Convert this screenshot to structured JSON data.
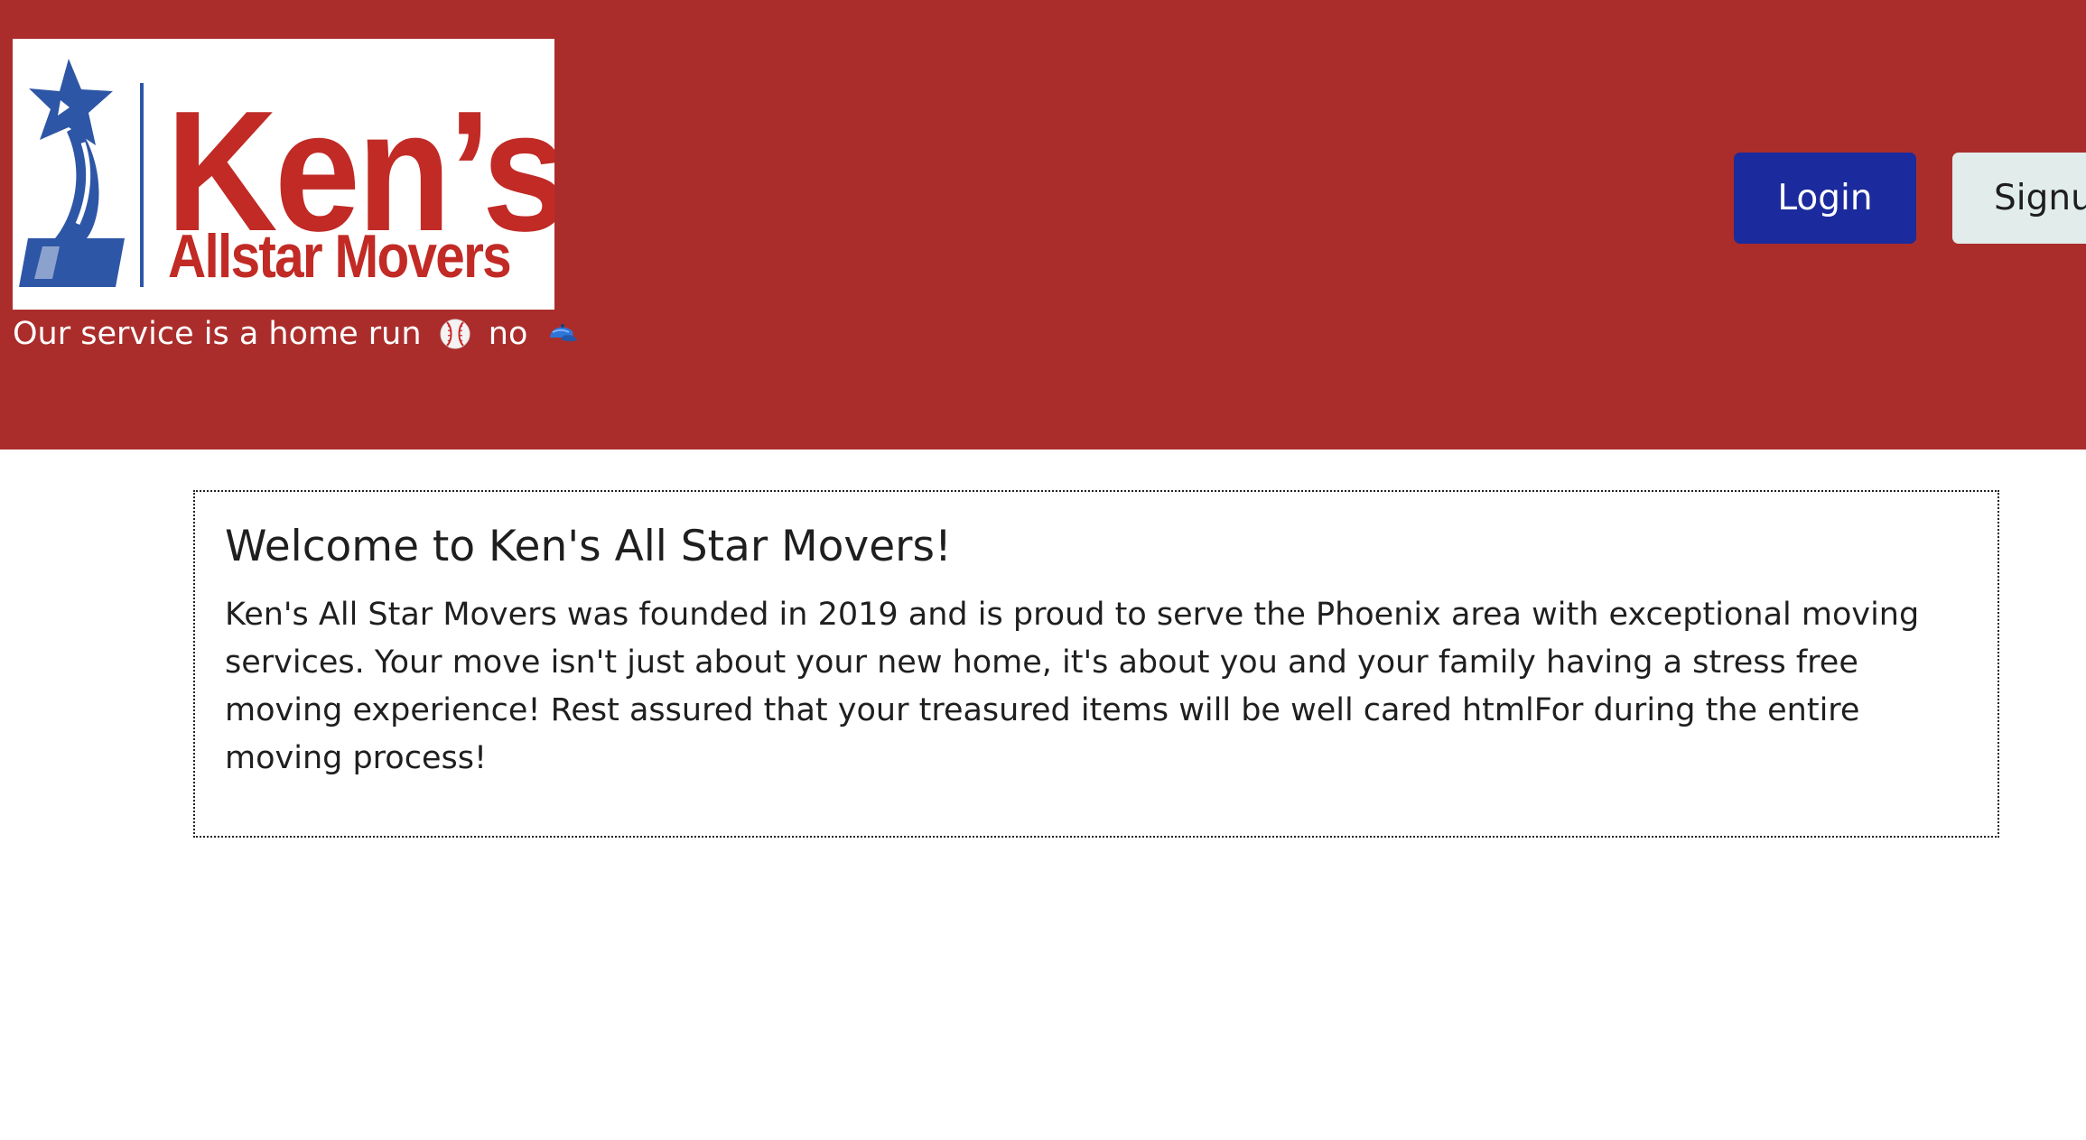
{
  "header": {
    "logo": {
      "title": "Ken’s",
      "subtitle": "Allstar Movers"
    },
    "tagline": {
      "text_before": "Our service is a home run",
      "icon_1": "baseball-icon",
      "text_middle": "no",
      "icon_2": "baseball-cap-icon"
    },
    "login_label": "Login",
    "signup_label": "Signu"
  },
  "main": {
    "title": "Welcome to Ken's All Star Movers!",
    "body": "Ken's All Star Movers was founded in 2019 and is proud to serve the Phoenix area with exceptional moving services. Your move isn't just about your new home, it's about you and your family having a stress free moving experience! Rest assured that your treasured items will be well cared htmlFor during the entire moving process!"
  },
  "colors": {
    "header_background": "#ab2d2b",
    "logo_red": "#c12a25",
    "logo_blue": "#2e56a6",
    "login_button": "#1b2a9c",
    "signup_button": "#e1eceb",
    "text": "#1f1f1f"
  }
}
